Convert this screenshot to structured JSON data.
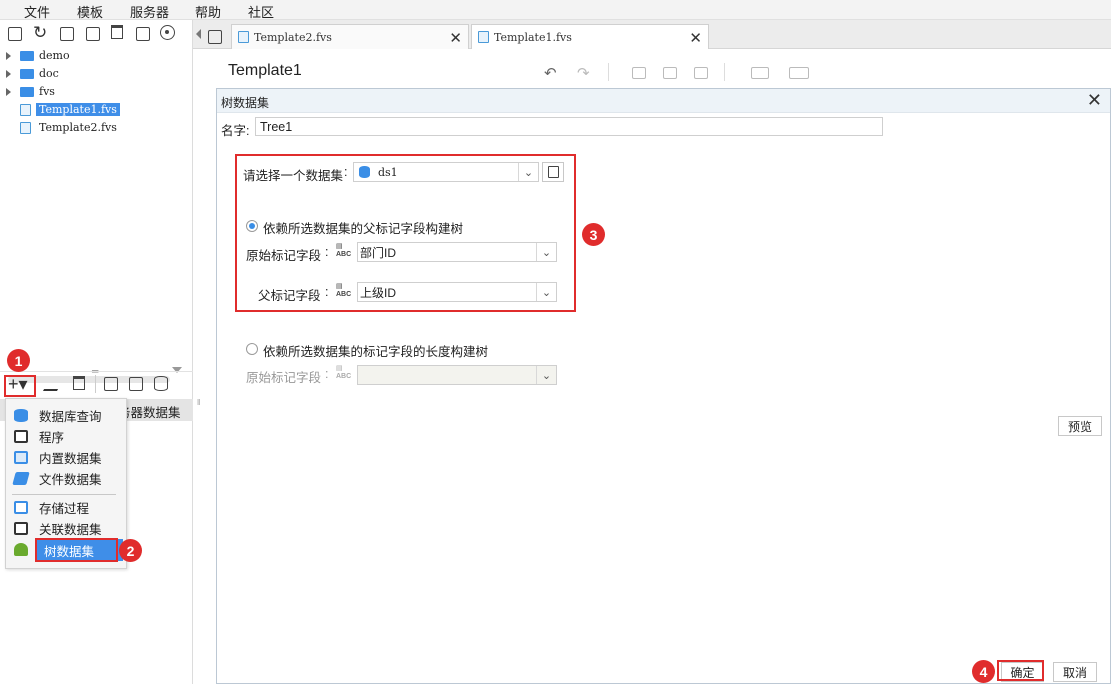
{
  "menubar": {
    "items": [
      "文件",
      "模板",
      "服务器",
      "帮助",
      "社区"
    ]
  },
  "tree": {
    "items": [
      {
        "label": "demo",
        "type": "folder"
      },
      {
        "label": "doc",
        "type": "folder"
      },
      {
        "label": "fvs",
        "type": "folder"
      },
      {
        "label": "Template1.fvs",
        "type": "file",
        "selected": true
      },
      {
        "label": "Template2.fvs",
        "type": "file"
      }
    ]
  },
  "dataset_panel": {
    "partial_header": "务器数据集"
  },
  "add_menu": {
    "items": [
      "数据库查询",
      "程序",
      "内置数据集",
      "文件数据集",
      "存储过程",
      "关联数据集",
      "树数据集"
    ],
    "icons": [
      "database-icon",
      "program-icon",
      "builtin-dataset-icon",
      "file-dataset-icon",
      "stored-procedure-icon",
      "relation-dataset-icon",
      "tree-icon"
    ]
  },
  "badges": {
    "b1": "1",
    "b2": "2",
    "b3": "3",
    "b4": "4"
  },
  "tabs": [
    {
      "label": "Template2.fvs",
      "active": false
    },
    {
      "label": "Template1.fvs",
      "active": true
    }
  ],
  "document": {
    "title": "Template1"
  },
  "dialog": {
    "title": "树数据集",
    "name_label": "名字:",
    "name_value": "Tree1",
    "select_dataset_label": "请选择一个数据集",
    "dataset_value": "ds1",
    "option1_label": "依赖所选数据集的父标记字段构建树",
    "orig_field_label": "原始标记字段",
    "orig_field_value": "部门ID",
    "parent_field_label": "父标记字段",
    "parent_field_value": "上级ID",
    "option2_label": "依赖所选数据集的标记字段的长度构建树",
    "orig_field2_label": "原始标记字段",
    "preview_label": "预览",
    "ok_label": "确定",
    "cancel_label": "取消",
    "colon": ":"
  },
  "colors": {
    "accent": "#3f8ee8",
    "annotation_red": "#e02c2c",
    "dialog_header": "#edf3f8"
  }
}
